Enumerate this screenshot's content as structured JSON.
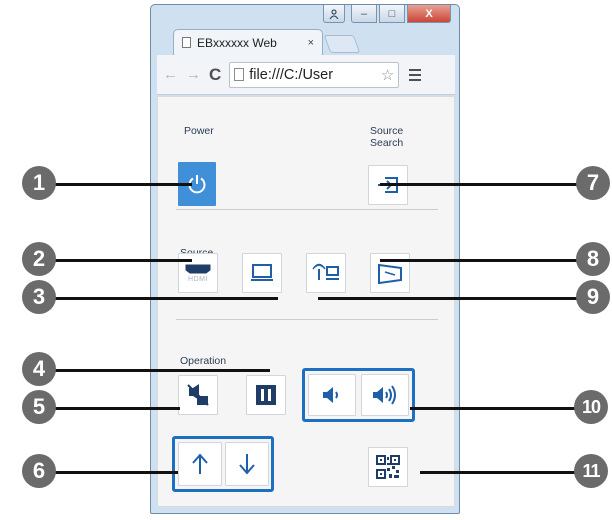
{
  "browser": {
    "tab_title": "EBxxxxxx Web",
    "tab_close": "×",
    "address": "file:///C:/User",
    "controls": {
      "minimize": "–",
      "maximize": "□",
      "close": "X"
    }
  },
  "panel": {
    "power_label": "Power",
    "source_search_label_line1": "Source",
    "source_search_label_line2": "Search",
    "source_label": "Source",
    "operation_label": "Operation",
    "hdmi_text": "HDMI"
  },
  "callouts": [
    "1",
    "2",
    "3",
    "4",
    "5",
    "6",
    "7",
    "8",
    "9",
    "10",
    "11"
  ],
  "colors": {
    "accent": "#1d6fc2",
    "power_button": "#3f8fd9",
    "callout_circle": "#6b6b6b"
  },
  "icons": [
    "power-icon",
    "source-search-icon",
    "hdmi-icon",
    "computer-icon",
    "lan-icon",
    "screen-mirroring-icon",
    "a-v-mute-icon",
    "freeze-icon",
    "volume-down-icon",
    "volume-up-icon",
    "page-up-icon",
    "page-down-icon",
    "qr-code-icon"
  ]
}
